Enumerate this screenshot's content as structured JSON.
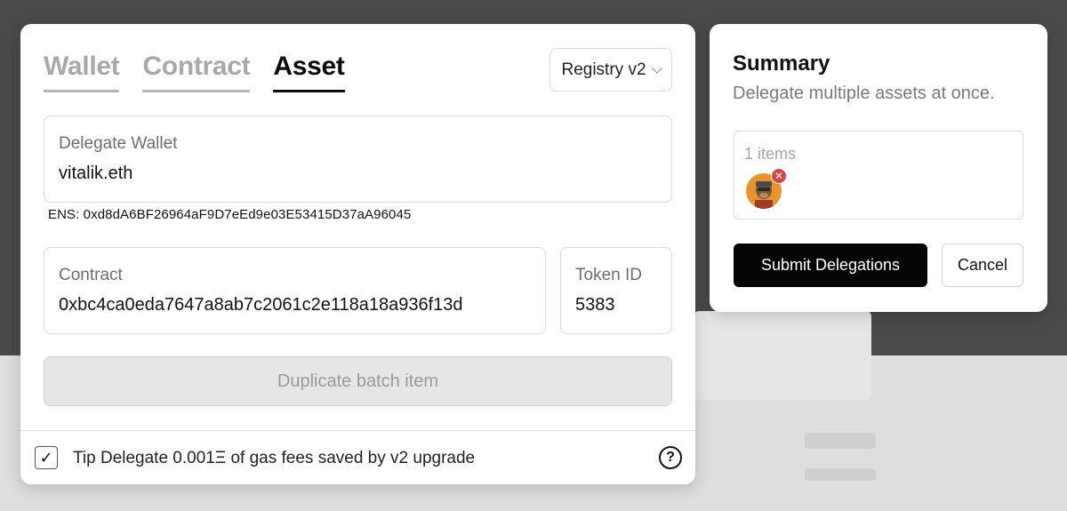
{
  "tabs": [
    "Wallet",
    "Contract",
    "Asset"
  ],
  "active_tab": "Asset",
  "registry": {
    "selected": "Registry v2"
  },
  "delegate": {
    "label": "Delegate Wallet",
    "value": "vitalik.eth",
    "ens": "ENS: 0xd8dA6BF26964aF9D7eEd9e03E53415D37aA96045"
  },
  "contract": {
    "label": "Contract",
    "value": "0xbc4ca0eda7647a8ab7c2061c2e118a18a936f13d"
  },
  "token": {
    "label": "Token ID",
    "value": "5383"
  },
  "duplicate_button": "Duplicate batch item",
  "footer": {
    "tip_text": "Tip Delegate 0.001Ξ of gas fees saved by v2 upgrade",
    "checked": "✓",
    "help": "?"
  },
  "summary": {
    "title": "Summary",
    "subtitle": "Delegate multiple assets at once.",
    "items_count": "1 items",
    "submit_label": "Submit Delegations",
    "cancel_label": "Cancel"
  },
  "colors": {
    "accent": "#050505",
    "remove_badge": "#d9463d",
    "disabled_bg": "#e6e6e6"
  }
}
